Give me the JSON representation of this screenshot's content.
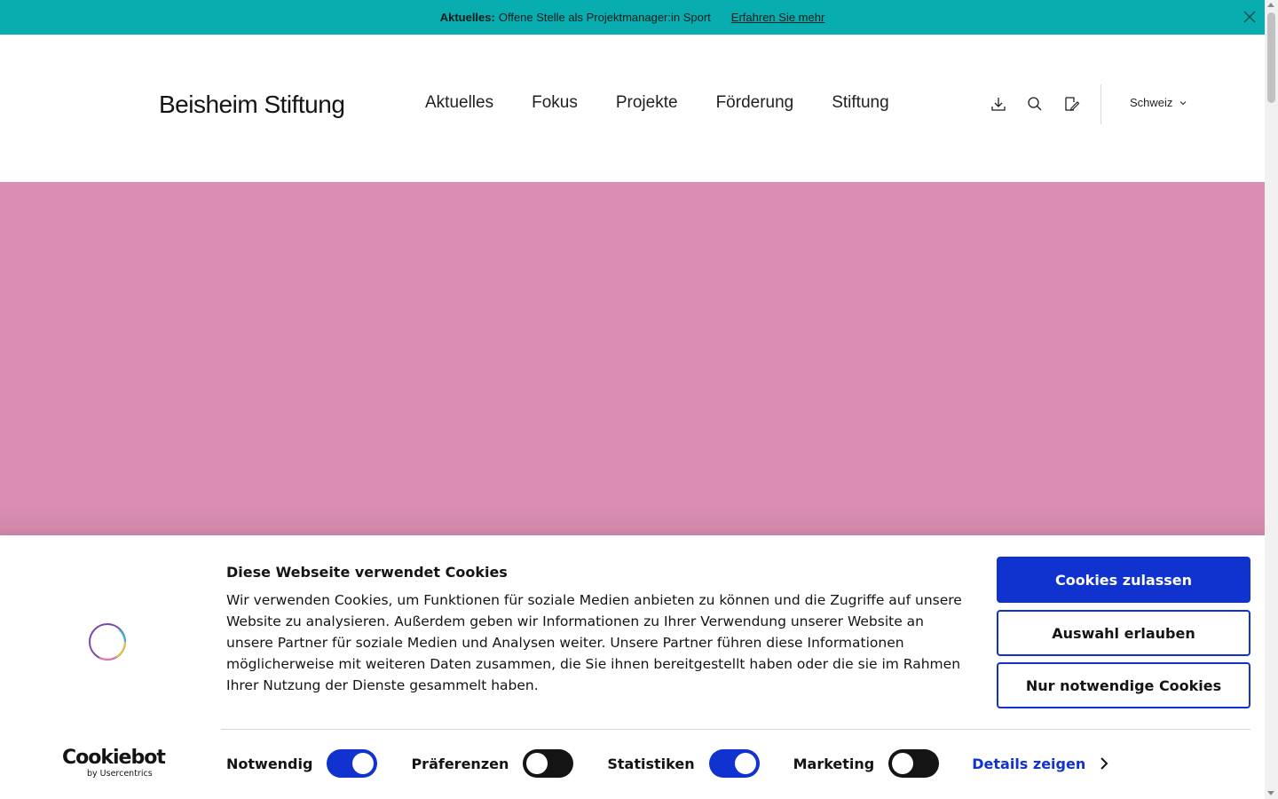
{
  "colors": {
    "announce_bg": "#08adaf",
    "hero_bg": "#db8eb2",
    "accent": "#1032cf"
  },
  "announcement": {
    "lead": "Aktuelles:",
    "text": "Offene Stelle als Projektmanager:in Sport",
    "link": "Erfahren Sie mehr",
    "close_icon": "close-icon"
  },
  "header": {
    "logo": "Beisheim Stiftung",
    "nav": [
      "Aktuelles",
      "Fokus",
      "Projekte",
      "Förderung",
      "Stiftung"
    ],
    "tools": [
      "download-icon",
      "search-icon",
      "edit-note-icon"
    ],
    "language": "Schweiz"
  },
  "cookie": {
    "title": "Diese Webseite verwendet Cookies",
    "text": "Wir verwenden Cookies, um Funktionen für soziale Medien anbieten zu können und die Zugriffe auf unsere Website zu analysieren. Außerdem geben wir Informationen zu Ihrer Verwendung unserer Website an unsere Partner für soziale Medien und Analysen weiter. Unsere Partner führen diese Informationen möglicherweise mit weiteren Daten zusammen, die Sie ihnen bereitgestellt haben oder die sie im Rahmen Ihrer Nutzung der Dienste gesammelt haben.",
    "buttons": {
      "allow_all": "Cookies zulassen",
      "allow_selection": "Auswahl erlauben",
      "necessary_only": "Nur notwendige Cookies"
    },
    "brand": {
      "name": "Cookiebot",
      "sub": "by Usercentrics"
    },
    "toggles": [
      {
        "label": "Notwendig",
        "on": true
      },
      {
        "label": "Präferenzen",
        "on": false
      },
      {
        "label": "Statistiken",
        "on": true
      },
      {
        "label": "Marketing",
        "on": false
      }
    ],
    "details": "Details zeigen"
  }
}
